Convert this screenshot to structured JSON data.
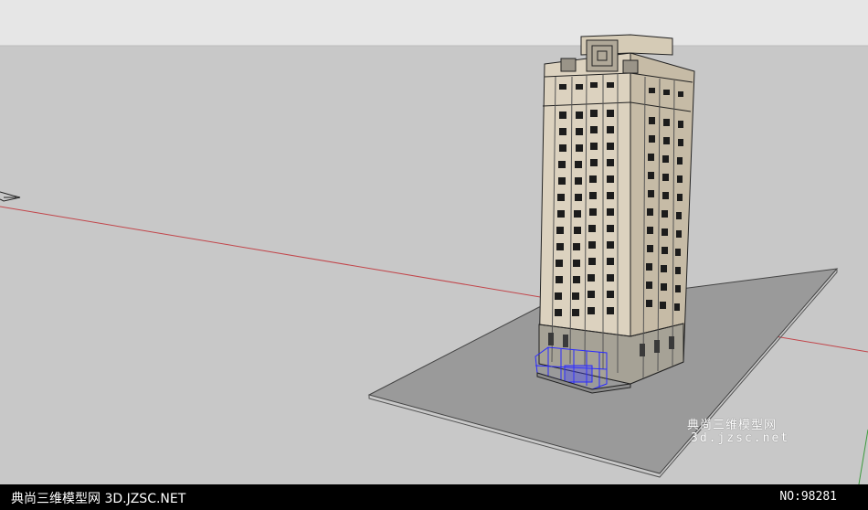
{
  "scene": {
    "colors": {
      "sky": "#e6e6e6",
      "ground": "#c8c8c8",
      "red_axis": "#c2454a",
      "green_axis": "#3c9a3c",
      "platform": "#9a9a9a",
      "facade": "#dcd2bf",
      "facade_shade": "#c6bba6",
      "base": "#a6a296",
      "window": "#1c1c1c",
      "blue_selection": "#2a2aff"
    },
    "model": "high-rise residential tower on a ground slab",
    "icons": [
      "axis-origin-icon"
    ]
  },
  "watermark": {
    "brand_cn": "典尚三维模型网",
    "url": "3d.jzsc.net"
  },
  "footer": {
    "left": "典尚三维模型网 3D.JZSC.NET",
    "right": "NO:98281"
  }
}
